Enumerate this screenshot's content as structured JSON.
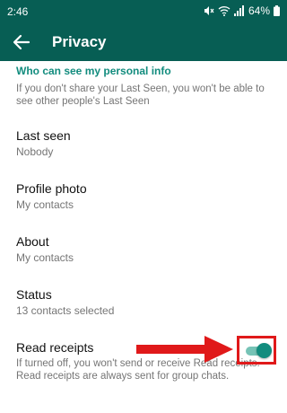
{
  "status_bar": {
    "time": "2:46",
    "battery": "64%",
    "icons": [
      "mute-icon",
      "wifi-icon",
      "signal-icon",
      "battery-icon"
    ]
  },
  "app_bar": {
    "back_icon": "arrow-left-icon",
    "title": "Privacy"
  },
  "section": {
    "header": "Who can see my personal info",
    "description": "If you don't share your Last Seen, you won't be able to see other people's Last Seen"
  },
  "settings": [
    {
      "label": "Last seen",
      "value": "Nobody"
    },
    {
      "label": "Profile photo",
      "value": "My contacts"
    },
    {
      "label": "About",
      "value": "My contacts"
    },
    {
      "label": "Status",
      "value": "13 contacts selected"
    }
  ],
  "read_receipts": {
    "label": "Read receipts",
    "description": "If turned off, you won't send or receive Read receipts. Read receipts are always sent for group chats.",
    "enabled": true
  },
  "colors": {
    "primary": "#075e54",
    "accent": "#128c7e",
    "highlight": "#e0191a"
  }
}
